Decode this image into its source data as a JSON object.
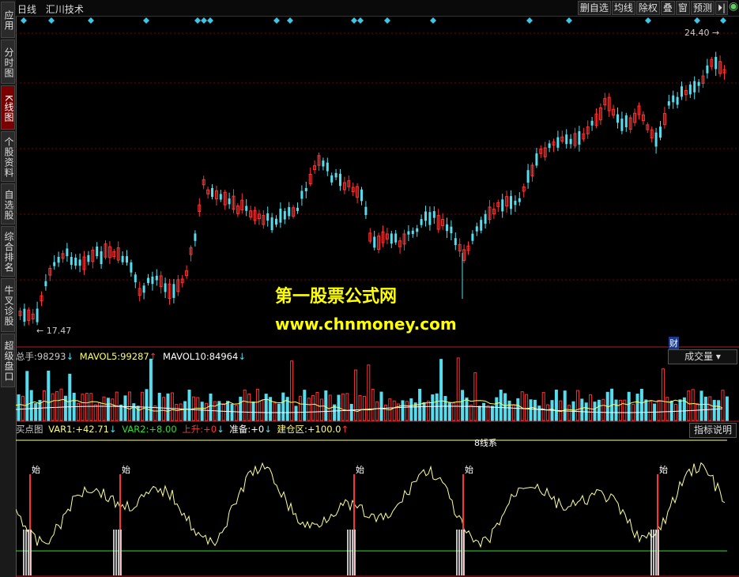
{
  "sidebar": {
    "tabs": [
      {
        "label": "应用",
        "active": false
      },
      {
        "label": "分时图",
        "active": false
      },
      {
        "label": "K线图",
        "active": true
      },
      {
        "label": "个股资料",
        "active": false
      },
      {
        "label": "自选股",
        "active": false
      },
      {
        "label": "综合排名",
        "active": false
      },
      {
        "label": "牛叉诊股",
        "active": false
      },
      {
        "label": "超级盘口",
        "active": false
      }
    ]
  },
  "header": {
    "period": "日线",
    "stock_name": "汇川技术",
    "buttons": [
      "删自选",
      "均线",
      "除权",
      "叠",
      "窗",
      "预测",
      "⏵|"
    ]
  },
  "price_labels": {
    "high": "24.40",
    "low": "17.47"
  },
  "watermark": {
    "line1": "第一股票公式网",
    "line2": "www.chnmoney.com"
  },
  "cai_badge": "财",
  "volume_panel": {
    "label_total": "总手:",
    "total": "98293",
    "total_arrow": "↓",
    "ma5_label": "MAVOL5:",
    "ma5": "99287",
    "ma5_arrow": "↑",
    "ma10_label": "MAVOL10:",
    "ma10": "84964",
    "ma10_arrow": "↓",
    "selector": "成交量"
  },
  "indicator_panel": {
    "name": "买点图",
    "var1_label": "VAR1:",
    "var1": "+42.71",
    "var1_arrow": "↓",
    "var2_label": "VAR2:",
    "var2": "+8.00",
    "up_label": "上升:",
    "up": "+0",
    "up_arrow": "↓",
    "ready_label": "准备:",
    "ready": "+0",
    "ready_arrow": "↓",
    "build_label": "建仓区:",
    "build": "+100.0",
    "build_arrow": "↑",
    "help_button": "指标说明",
    "top_text": "8线系",
    "buy_mark": "始",
    "signal_color": "#ff3333",
    "line_color": "#ffff99"
  },
  "colors": {
    "up": "#ff3333",
    "down": "#55ddee",
    "grid": "#7a0000",
    "diamond": "#3fc6e6"
  }
}
